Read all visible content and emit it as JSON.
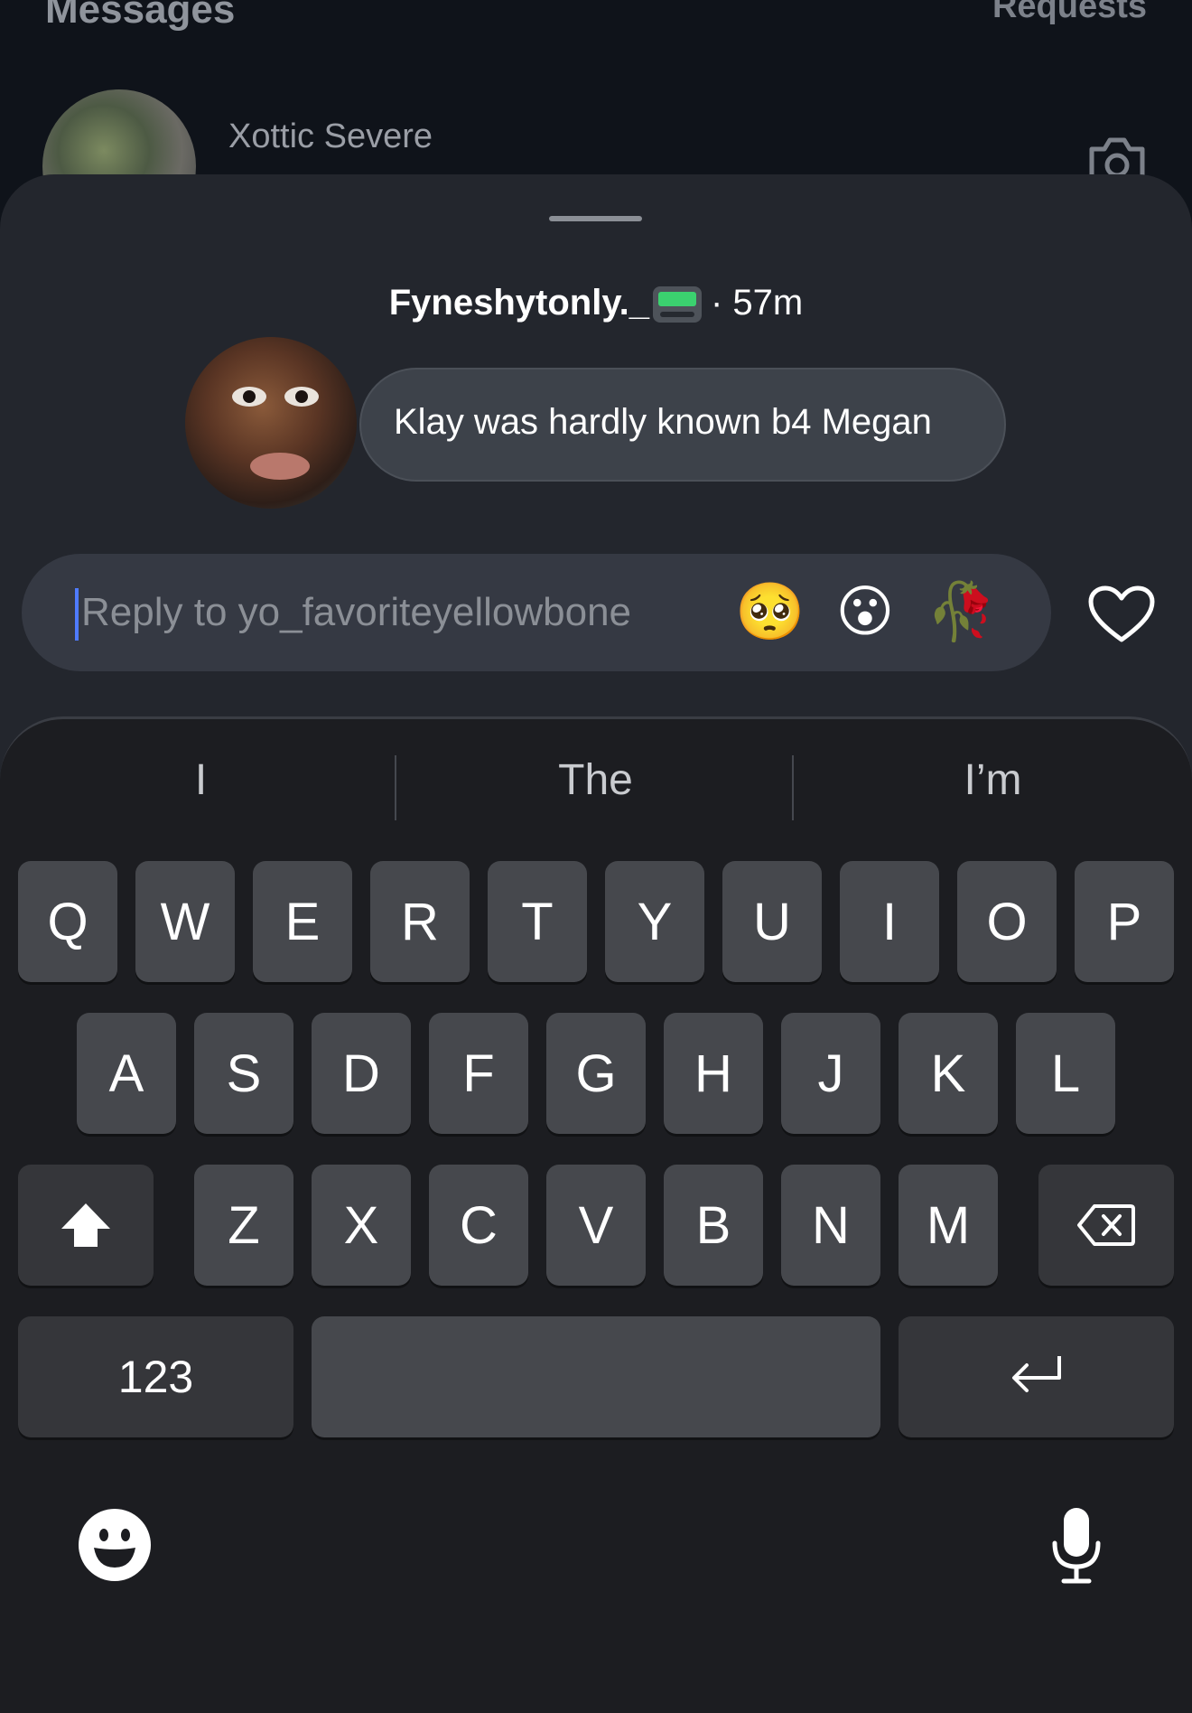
{
  "background": {
    "title": "Messages",
    "requests": "Requests",
    "thread_name": "Xottic Severe"
  },
  "story": {
    "username": "Fyneshytonly._",
    "time": "· 57m",
    "message": "Klay was hardly known b4 Megan"
  },
  "reply": {
    "placeholder": "Reply to yo_favoriteyellowbone",
    "reactions": [
      "🥺",
      "😮",
      "🥀"
    ]
  },
  "keyboard": {
    "suggestions": [
      "I",
      "The",
      "I’m"
    ],
    "row1": [
      "Q",
      "W",
      "E",
      "R",
      "T",
      "Y",
      "U",
      "I",
      "O",
      "P"
    ],
    "row2": [
      "A",
      "S",
      "D",
      "F",
      "G",
      "H",
      "J",
      "K",
      "L"
    ],
    "row3": [
      "Z",
      "X",
      "C",
      "V",
      "B",
      "N",
      "M"
    ],
    "numbers_label": "123"
  },
  "colors": {
    "sheet": "#23262d",
    "keyboard_bg": "#1c1d21",
    "key": "#46484d",
    "caret": "#4f7bff"
  },
  "icons": [
    "camera-icon",
    "heart-icon",
    "shift-icon",
    "backspace-icon",
    "return-icon",
    "emoji-icon",
    "microphone-icon"
  ]
}
